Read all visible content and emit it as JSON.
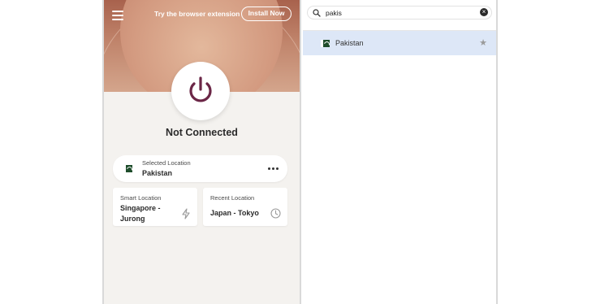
{
  "vpn": {
    "promo_text": "Try the browser extension",
    "install_label": "Install Now",
    "status": "Not Connected",
    "selected": {
      "label": "Selected Location",
      "value": "Pakistan"
    },
    "smart": {
      "label": "Smart Location",
      "value_line1": "Singapore -",
      "value_line2": "Jurong"
    },
    "recent": {
      "label": "Recent Location",
      "value": "Japan - Tokyo"
    }
  },
  "search": {
    "value": "pakis",
    "results": [
      {
        "name": "Pakistan"
      }
    ]
  },
  "colors": {
    "brand": "#6b2646",
    "highlight": "#dde7f7"
  }
}
